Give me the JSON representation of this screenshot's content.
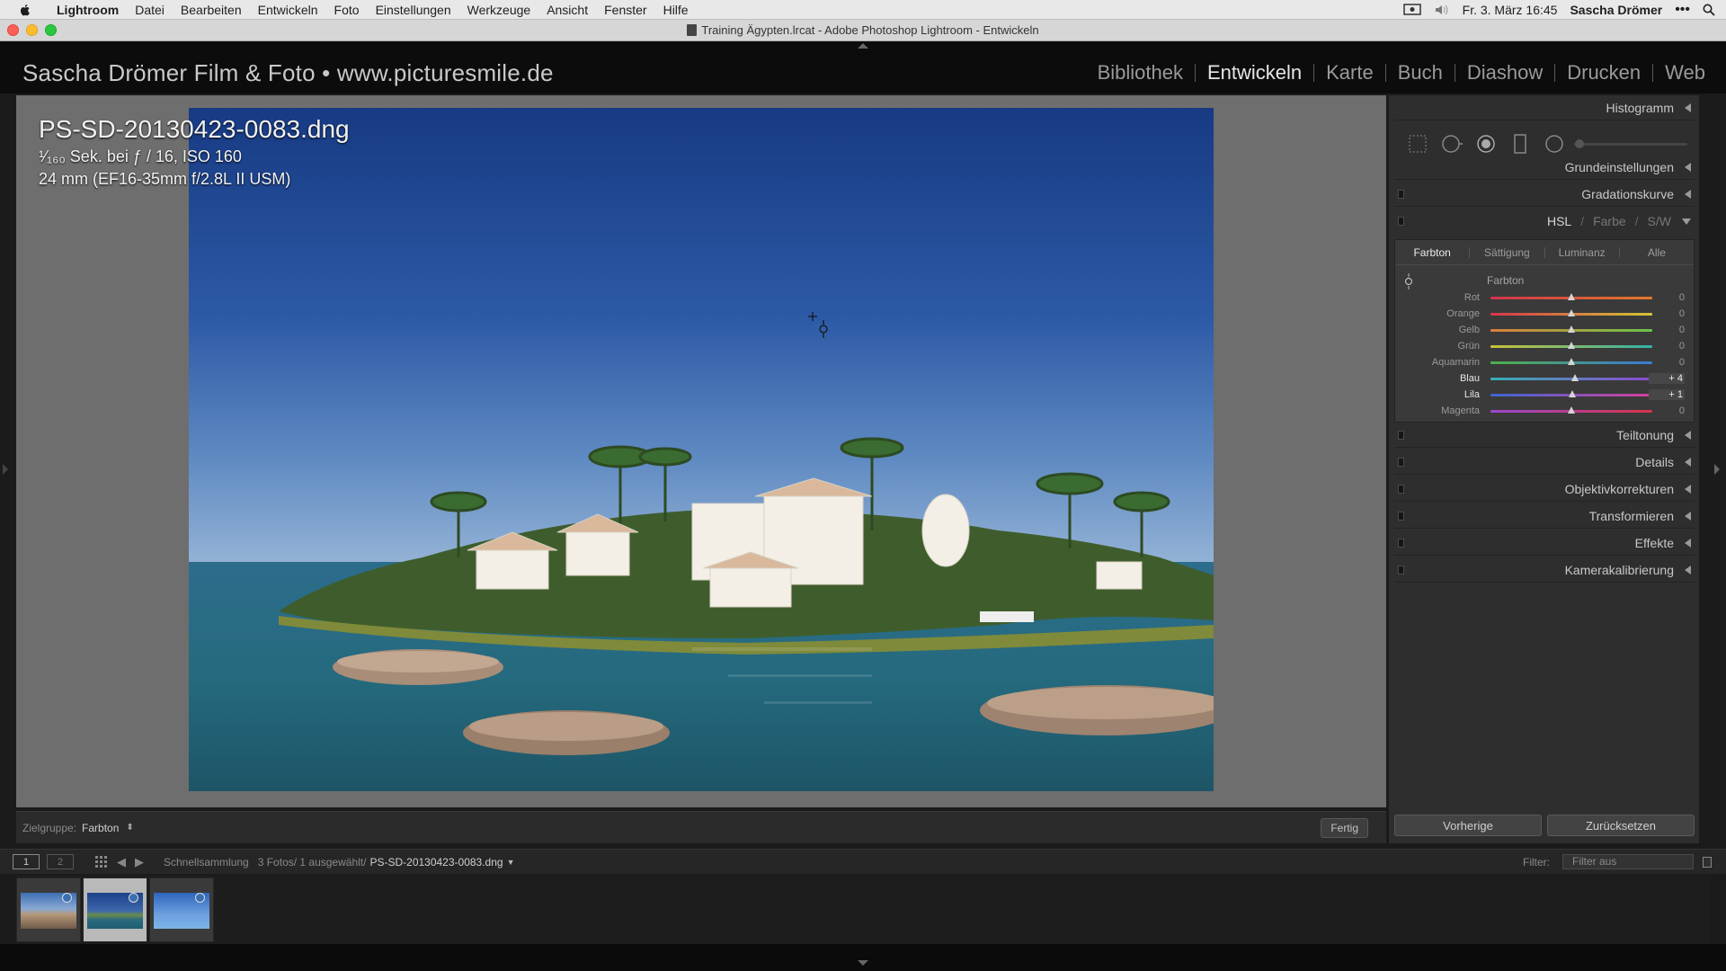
{
  "menubar": {
    "app": "Lightroom",
    "items": [
      "Datei",
      "Bearbeiten",
      "Entwickeln",
      "Foto",
      "Einstellungen",
      "Werkzeuge",
      "Ansicht",
      "Fenster",
      "Hilfe"
    ],
    "datetime": "Fr. 3. März 16:45",
    "user": "Sascha Drömer"
  },
  "window": {
    "title": "Training Ägypten.lrcat - Adobe Photoshop Lightroom - Entwickeln"
  },
  "identity": "Sascha Drömer Film & Foto • www.picturesmile.de",
  "modules": [
    "Bibliothek",
    "Entwickeln",
    "Karte",
    "Buch",
    "Diashow",
    "Drucken",
    "Web"
  ],
  "active_module": "Entwickeln",
  "photo_info": {
    "filename": "PS-SD-20130423-0083.dng",
    "exposure": "¹⁄₁₆₀ Sek. bei ƒ / 16, ISO 160",
    "lens": "24 mm (EF16-35mm f/2.8L II USM)"
  },
  "toolbar": {
    "target_group_label": "Zielgruppe:",
    "target_group_value": "Farbton",
    "done": "Fertig"
  },
  "right_panel": {
    "histogram": "Histogramm",
    "sections_top": [
      "Grundeinstellungen",
      "Gradationskurve"
    ],
    "hsl_header": {
      "hsl": "HSL",
      "sep1": "/",
      "farbe": "Farbe",
      "sep2": "/",
      "sw": "S/W"
    },
    "hsl_tabs": [
      "Farbton",
      "Sättigung",
      "Luminanz",
      "Alle"
    ],
    "hsl_subtitle": "Farbton",
    "sliders": [
      {
        "label": "Rot",
        "value": "0",
        "num": 0,
        "colors": [
          "#d0344d",
          "#e07a2a"
        ]
      },
      {
        "label": "Orange",
        "value": "0",
        "num": 0,
        "colors": [
          "#d8364b",
          "#d6c534"
        ]
      },
      {
        "label": "Gelb",
        "value": "0",
        "num": 0,
        "colors": [
          "#d9813a",
          "#6cc34a"
        ]
      },
      {
        "label": "Grün",
        "value": "0",
        "num": 0,
        "colors": [
          "#c7c23a",
          "#34b2a6"
        ]
      },
      {
        "label": "Aquamarin",
        "value": "0",
        "num": 0,
        "colors": [
          "#4bb24a",
          "#3a7ad4"
        ]
      },
      {
        "label": "Blau",
        "value": "+ 4",
        "num": 4,
        "colors": [
          "#36b0b4",
          "#8a4ad0"
        ]
      },
      {
        "label": "Lila",
        "value": "+ 1",
        "num": 1,
        "colors": [
          "#3d66d4",
          "#d4409e"
        ]
      },
      {
        "label": "Magenta",
        "value": "0",
        "num": 0,
        "colors": [
          "#9a48cc",
          "#d8344a"
        ]
      }
    ],
    "sections_bottom": [
      "Teiltonung",
      "Details",
      "Objektivkorrekturen",
      "Transformieren",
      "Effekte",
      "Kamerakalibrierung"
    ],
    "previous": "Vorherige",
    "reset": "Zurücksetzen"
  },
  "filmbar": {
    "screen1": "1",
    "screen2": "2",
    "source": "Schnellsammlung",
    "count": "3 Fotos/ 1 ausgewählt/",
    "current_file": "PS-SD-20130423-0083.dng",
    "filter_label": "Filter:",
    "filter_value": "Filter aus"
  },
  "colors": {
    "accent_text": "#e6e6e6",
    "panel_bg": "#2e2e2e",
    "viewer_bg": "#6e6e6e"
  }
}
